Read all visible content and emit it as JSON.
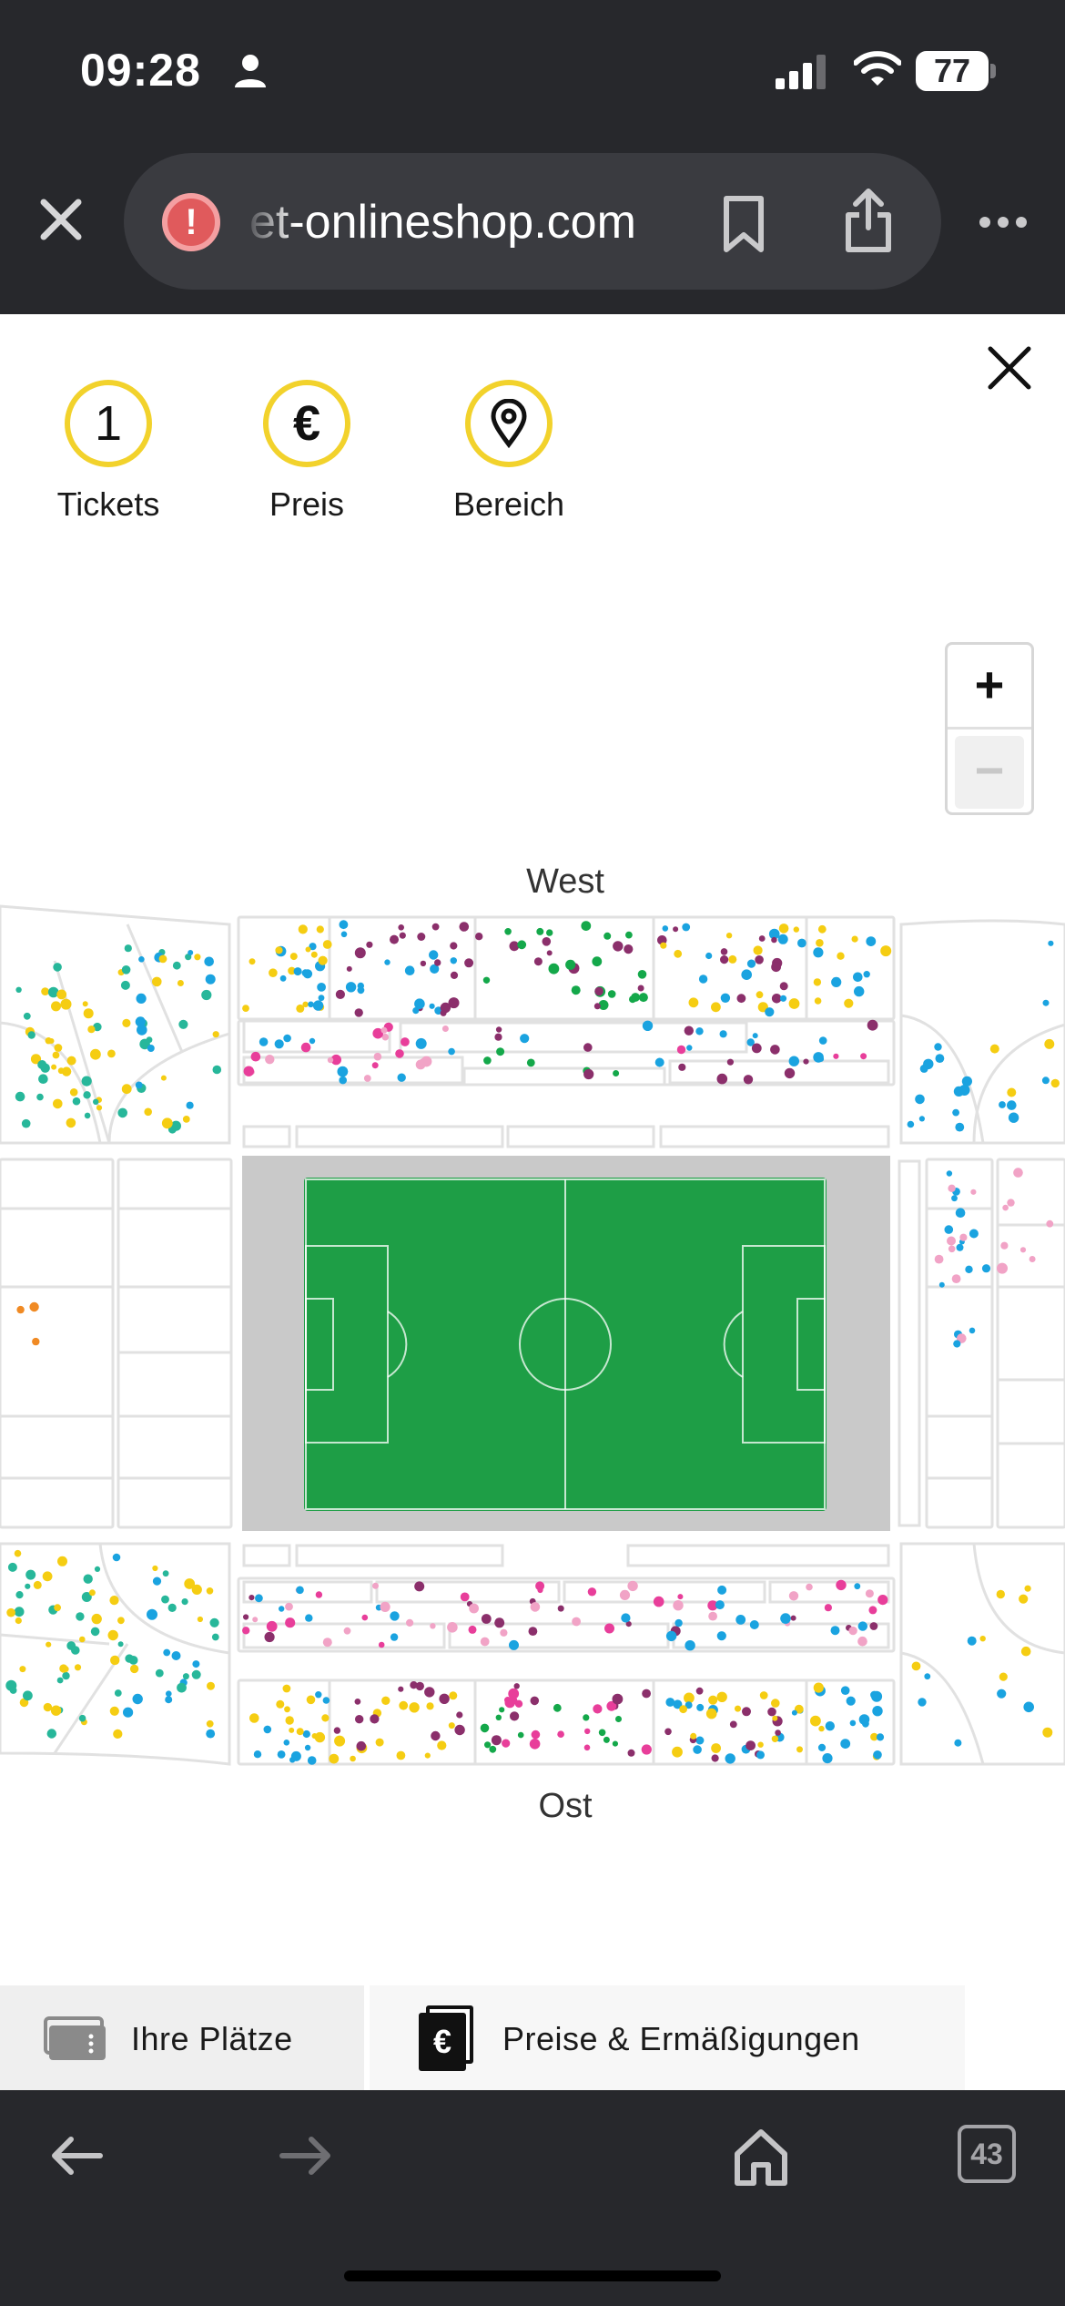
{
  "status_bar": {
    "time": "09:28",
    "battery": "77"
  },
  "browser": {
    "url": "et-onlineshop.com",
    "tab_count": "43"
  },
  "filters": [
    {
      "symbol": "1",
      "label": "Tickets"
    },
    {
      "symbol": "€",
      "label": "Preis"
    },
    {
      "symbol": "",
      "label": "Bereich"
    }
  ],
  "map": {
    "zoom_in": "+",
    "zoom_out": "−",
    "label_top": "West",
    "label_bottom": "Ost"
  },
  "tabs": {
    "seats": "Ihre Plätze",
    "prices": "Preise & Ermäßigungen",
    "prices_icon": "€"
  },
  "colors": {
    "accent_yellow": "#f2d22c",
    "pitch_green": "#1e9e46",
    "seat_yellow": "#f5cd12",
    "seat_blue": "#1aa3e0",
    "seat_purple": "#8b2f6b",
    "seat_pink": "#e83e9a",
    "seat_lightpink": "#f1a3c6",
    "seat_green": "#14a84a",
    "seat_teal": "#27b79a"
  }
}
